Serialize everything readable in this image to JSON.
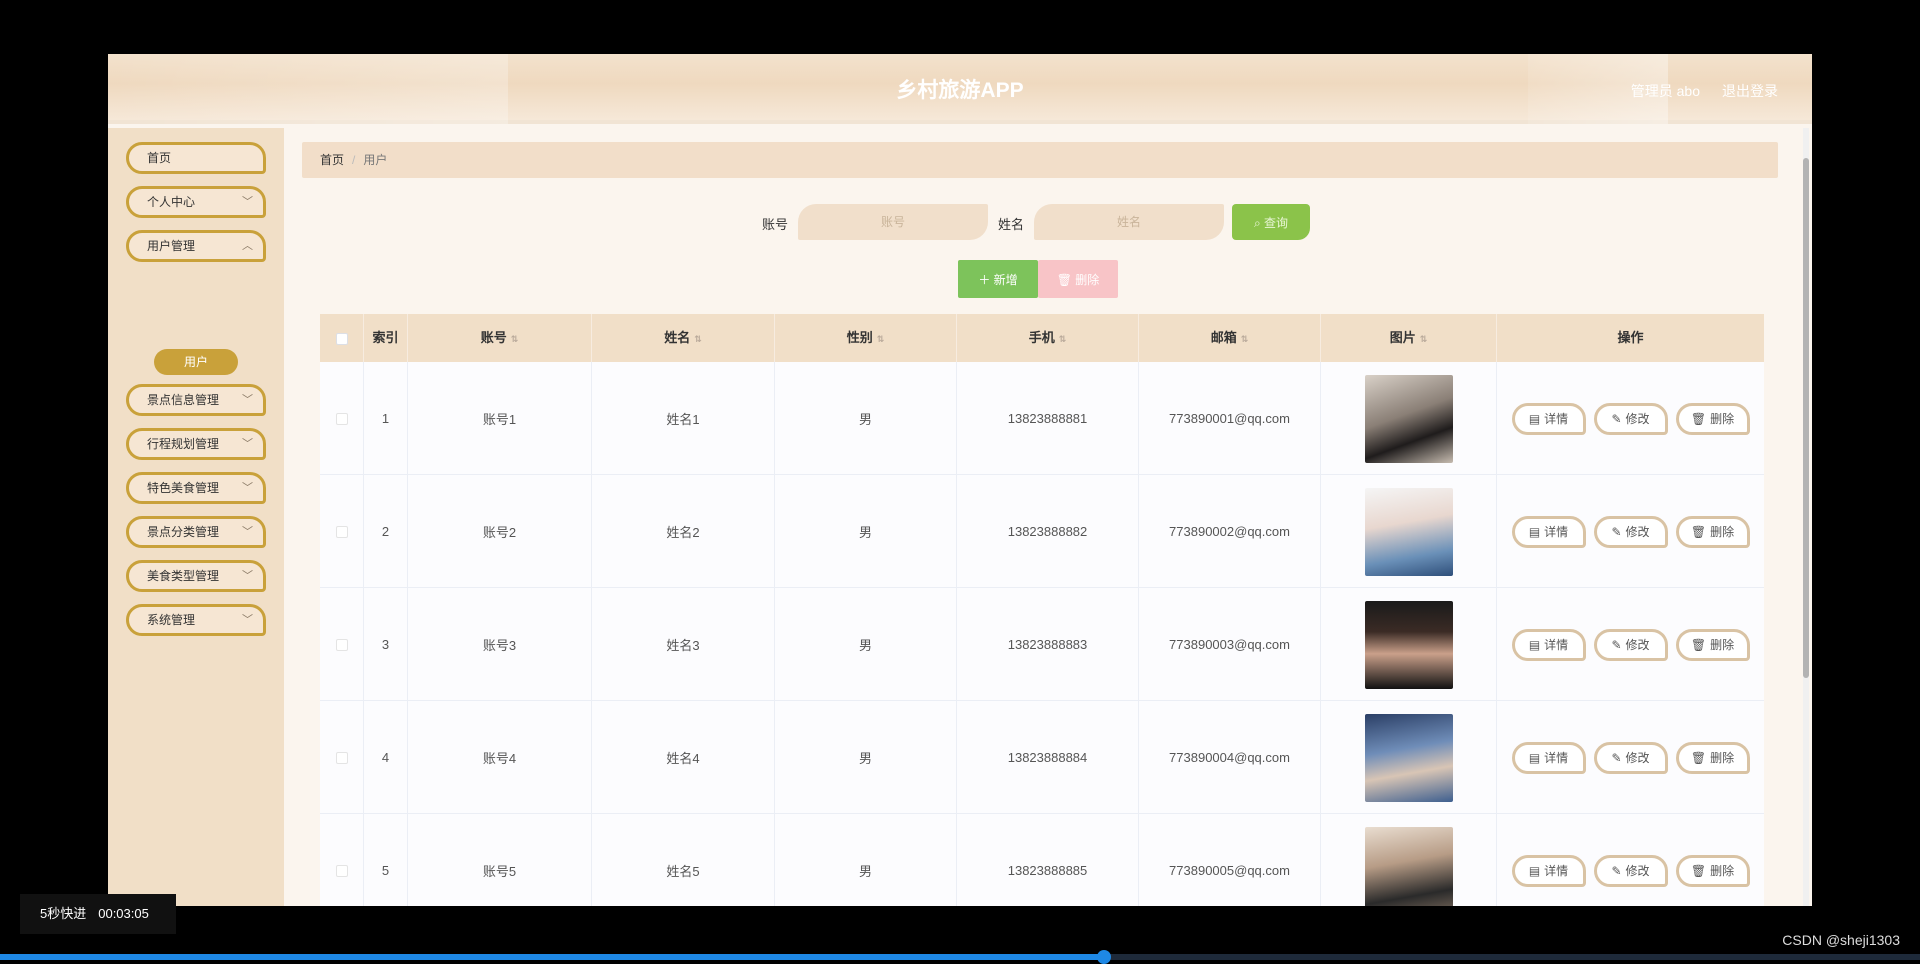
{
  "header": {
    "title": "乡村旅游APP",
    "user": "管理员 abo",
    "logout": "退出登录"
  },
  "sidebar": {
    "items": [
      {
        "label": "首页",
        "has_children": false
      },
      {
        "label": "个人中心",
        "has_children": true
      },
      {
        "label": "用户管理",
        "has_children": true
      },
      {
        "label": "景点信息管理",
        "has_children": true
      },
      {
        "label": "行程规划管理",
        "has_children": true
      },
      {
        "label": "特色美食管理",
        "has_children": true
      },
      {
        "label": "景点分类管理",
        "has_children": true
      },
      {
        "label": "美食类型管理",
        "has_children": true
      },
      {
        "label": "系统管理",
        "has_children": true
      }
    ],
    "active_sub": "用户"
  },
  "breadcrumb": {
    "home": "首页",
    "current": "用户"
  },
  "search": {
    "account_label": "账号",
    "account_placeholder": "账号",
    "name_label": "姓名",
    "name_placeholder": "姓名",
    "query_button": "查询"
  },
  "toolbar": {
    "add_button": "新增",
    "delete_button": "删除"
  },
  "table": {
    "columns": [
      "索引",
      "账号",
      "姓名",
      "性别",
      "手机",
      "邮箱",
      "图片",
      "操作"
    ],
    "actions": {
      "detail": "详情",
      "edit": "修改",
      "delete": "删除"
    },
    "rows": [
      {
        "index": "1",
        "account": "账号1",
        "name": "姓名1",
        "gender": "男",
        "phone": "13823888881",
        "email": "773890001@qq.com"
      },
      {
        "index": "2",
        "account": "账号2",
        "name": "姓名2",
        "gender": "男",
        "phone": "13823888882",
        "email": "773890002@qq.com"
      },
      {
        "index": "3",
        "account": "账号3",
        "name": "姓名3",
        "gender": "男",
        "phone": "13823888883",
        "email": "773890003@qq.com"
      },
      {
        "index": "4",
        "account": "账号4",
        "name": "姓名4",
        "gender": "男",
        "phone": "13823888884",
        "email": "773890004@qq.com"
      },
      {
        "index": "5",
        "account": "账号5",
        "name": "姓名5",
        "gender": "男",
        "phone": "13823888885",
        "email": "773890005@qq.com"
      }
    ]
  },
  "video": {
    "label": "5秒快进",
    "time": "00:03:05",
    "progress": 0.575
  },
  "watermark": "CSDN @sheji1303"
}
